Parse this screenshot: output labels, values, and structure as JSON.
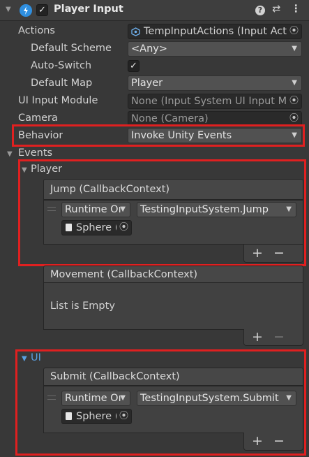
{
  "component": {
    "title": "Player Input",
    "enabled_check": "✓"
  },
  "header_icons": {
    "help": "?",
    "presets": "⇄",
    "menu": "⋮"
  },
  "props": {
    "actions_label": "Actions",
    "actions_value": "TempInputActions (Input Acti",
    "scheme_label": "Default Scheme",
    "scheme_value": "<Any>",
    "autoswitch_label": "Auto-Switch",
    "autoswitch_check": "✓",
    "map_label": "Default Map",
    "map_value": "Player",
    "ui_module_label": "UI Input Module",
    "ui_module_value": "None (Input System UI Input Mo",
    "camera_label": "Camera",
    "camera_value": "None (Camera)",
    "behavior_label": "Behavior",
    "behavior_value": "Invoke Unity Events"
  },
  "events": {
    "label": "Events",
    "player": {
      "label": "Player",
      "jump": {
        "header": "Jump (CallbackContext)",
        "runtime": "Runtime Oı",
        "function": "TestingInputSystem.Jump",
        "object": "Sphere ("
      },
      "movement": {
        "header": "Movement (CallbackContext)",
        "empty": "List is Empty"
      }
    },
    "ui": {
      "label": "UI",
      "submit": {
        "header": "Submit (CallbackContext)",
        "runtime": "Runtime Oı",
        "function": "TestingInputSystem.Submit",
        "object": "Sphere ("
      }
    },
    "add": "+",
    "remove": "−"
  }
}
